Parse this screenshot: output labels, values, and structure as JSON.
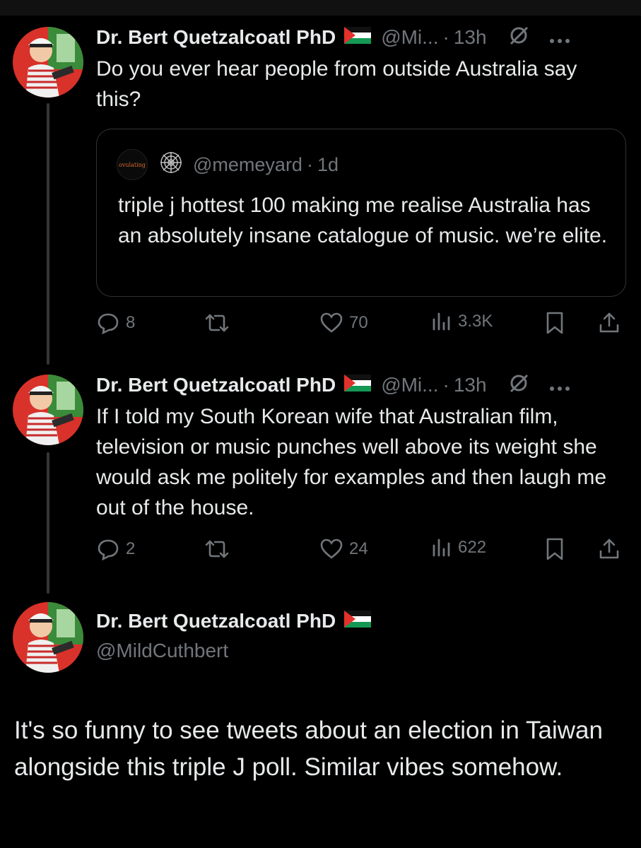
{
  "author": {
    "name": "Dr. Bert Quetzalcoatl PhD",
    "handle_short": "@Mi...",
    "handle_full": "@MildCuthbert"
  },
  "colors": {
    "background": "#000000",
    "text": "#e7e9ea",
    "muted": "#71767b",
    "border": "#2f3336",
    "flag_red": "#e4312b",
    "flag_green": "#149954"
  },
  "posts": [
    {
      "separator": "·",
      "time": "13h",
      "text": "Do you ever hear people from outside Australia say this?",
      "quote": {
        "avatar_text": "ovulating",
        "handle": "@memeyard",
        "separator": "·",
        "time": "1d",
        "text": "triple j hottest 100 making me realise Australia has an absolutely insane catalogue of music. we’re elite."
      },
      "stats": {
        "replies": "8",
        "likes": "70",
        "views": "3.3K"
      }
    },
    {
      "separator": "·",
      "time": "13h",
      "text": "If I told my South Korean wife that Australian film, television or music punches well above its weight she would ask me politely for examples and then laugh me out of the house.",
      "stats": {
        "replies": "2",
        "likes": "24",
        "views": "622"
      }
    }
  ],
  "main_post": {
    "text": "It's so funny to see tweets about an election in Taiwan alongside this triple J poll. Similar vibes somehow."
  },
  "icons": {
    "reply": "reply-icon",
    "retweet": "retweet-icon",
    "like": "like-icon",
    "views": "views-icon",
    "bookmark": "bookmark-icon",
    "share": "share-icon",
    "more": "more-icon",
    "grok": "grok-icon",
    "flag": "palestine-flag-icon"
  }
}
